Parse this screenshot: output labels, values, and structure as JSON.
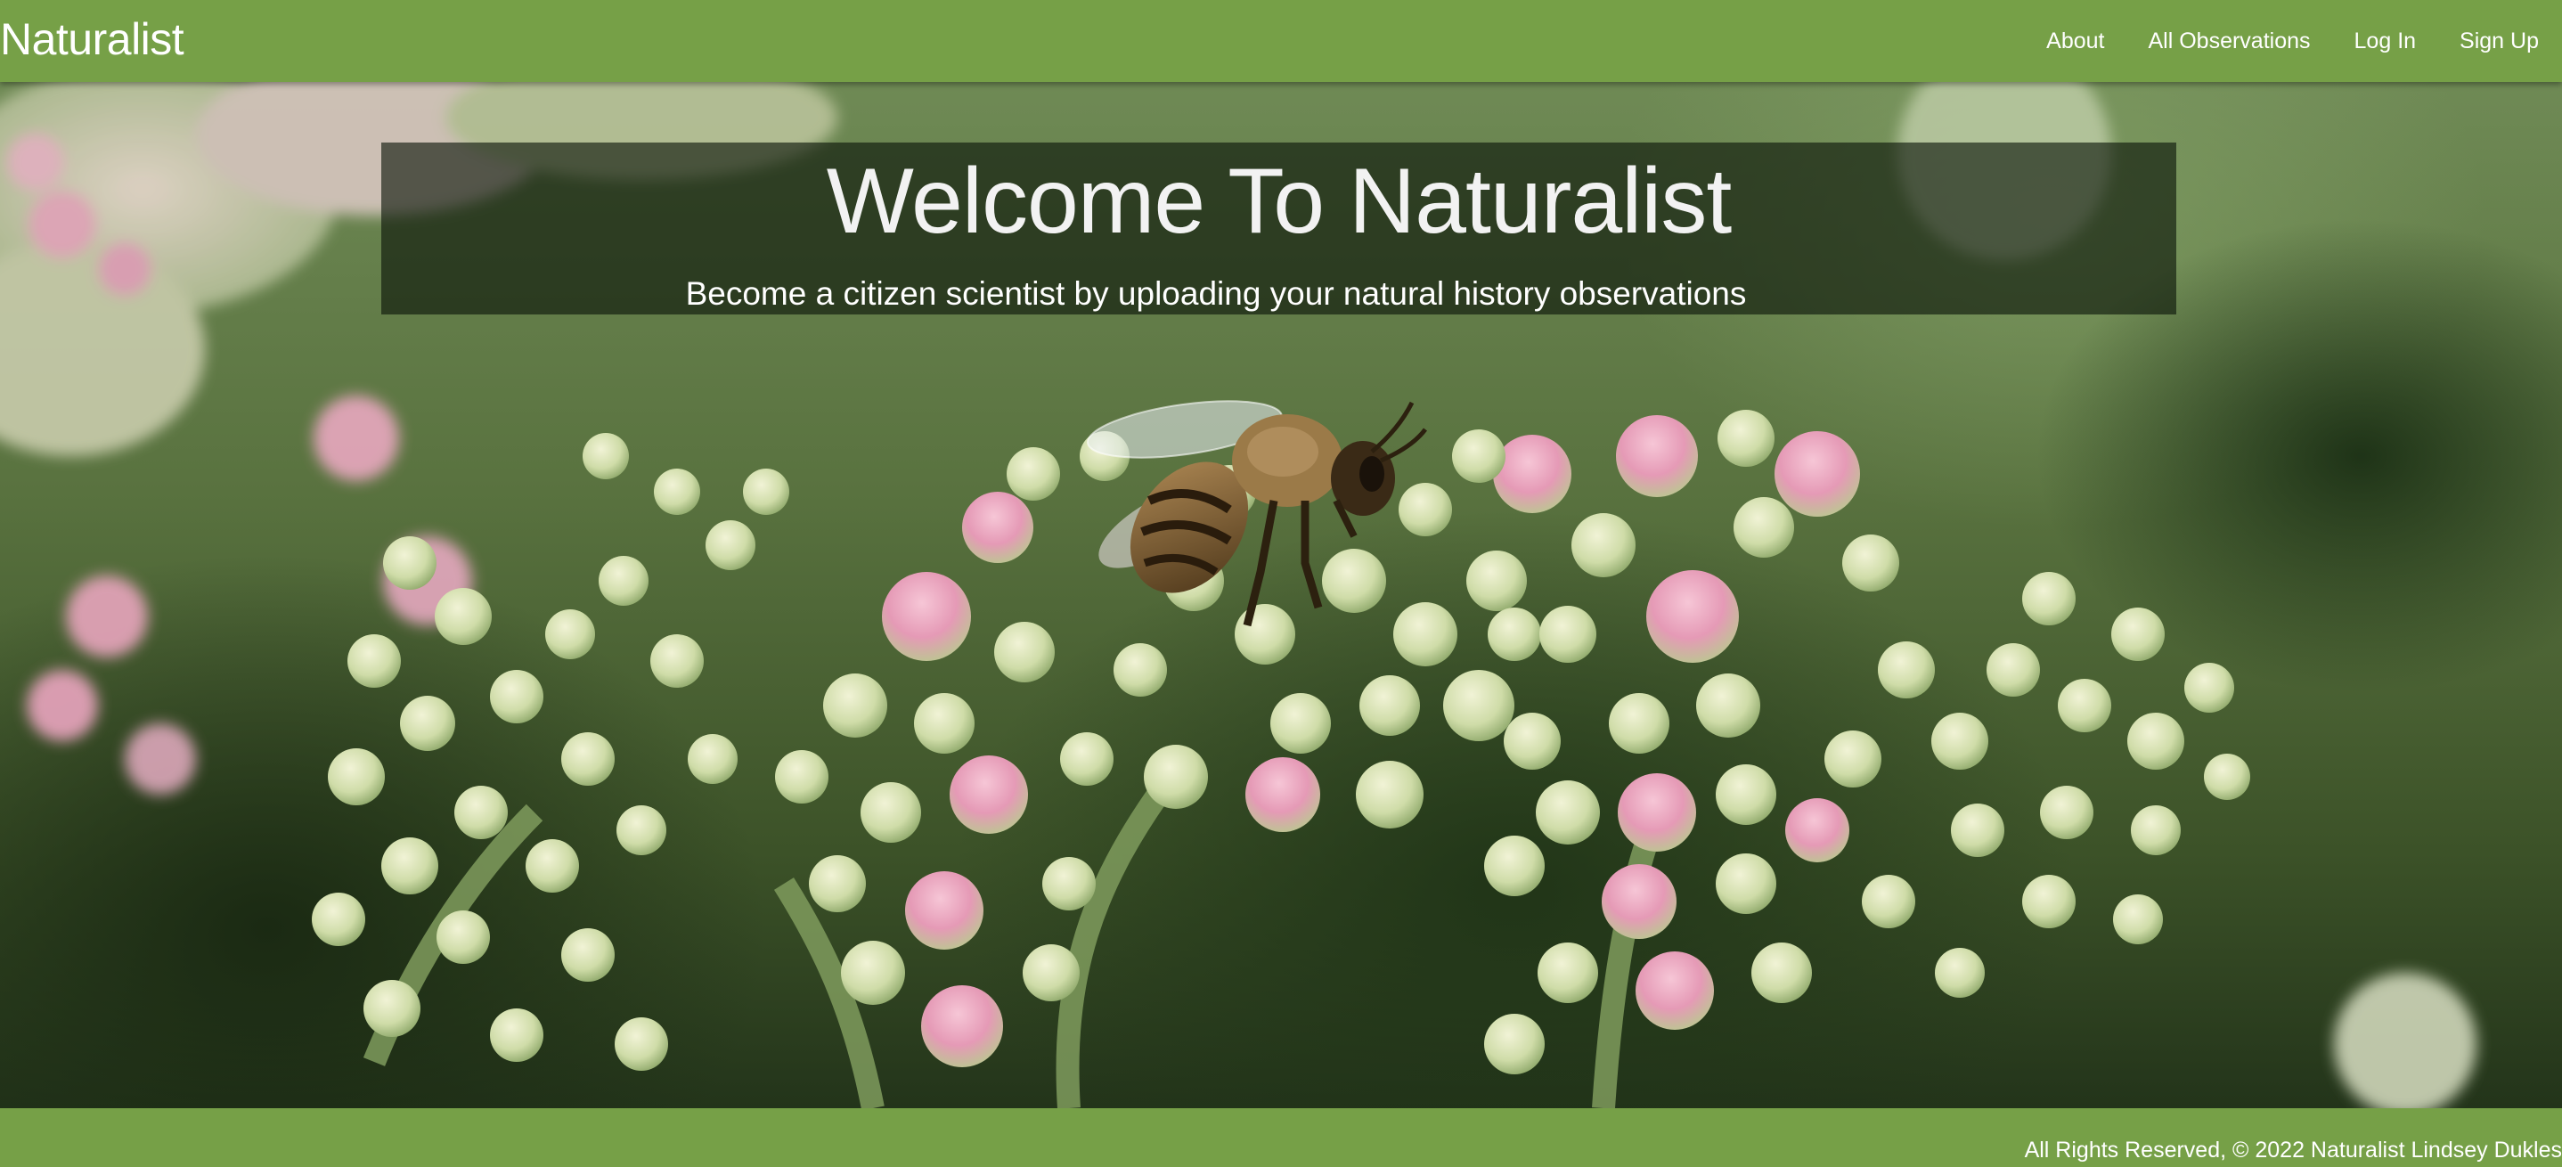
{
  "navbar": {
    "brand": "Naturalist",
    "links": {
      "about": "About",
      "all_observations": "All Observations",
      "log_in": "Log In",
      "sign_up": "Sign Up"
    }
  },
  "hero": {
    "title": "Welcome To Naturalist",
    "subtitle": "Become a citizen scientist by uploading your natural history observations"
  },
  "footer": {
    "text": "All Rights Reserved, © 2022 Naturalist Lindsey Dukles"
  },
  "colors": {
    "navbar_bg": "#76a047",
    "footer_bg": "#76a047",
    "text": "#ffffff",
    "banner_overlay": "rgba(10,20,8,0.62)"
  }
}
